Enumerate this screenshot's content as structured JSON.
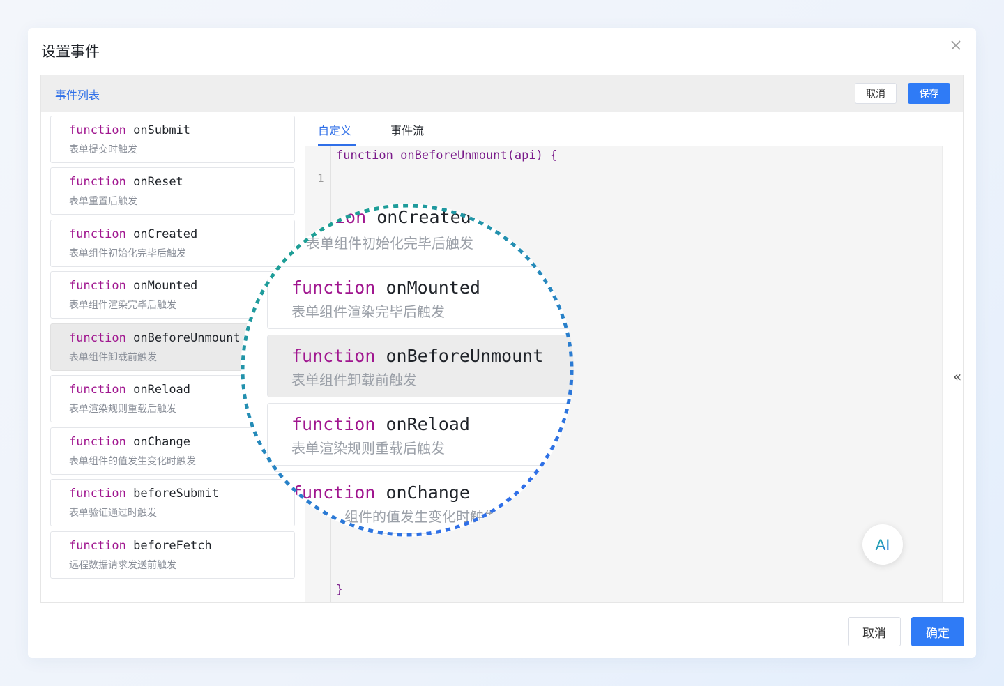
{
  "dialog": {
    "title": "设置事件"
  },
  "panel": {
    "title": "事件列表",
    "cancel_label": "取消",
    "save_label": "保存"
  },
  "events": [
    {
      "keyword": "function",
      "name": "onSubmit",
      "desc": "表单提交时触发"
    },
    {
      "keyword": "function",
      "name": "onReset",
      "desc": "表单重置后触发"
    },
    {
      "keyword": "function",
      "name": "onCreated",
      "desc": "表单组件初始化完毕后触发"
    },
    {
      "keyword": "function",
      "name": "onMounted",
      "desc": "表单组件渲染完毕后触发"
    },
    {
      "keyword": "function",
      "name": "onBeforeUnmount",
      "desc": "表单组件卸载前触发"
    },
    {
      "keyword": "function",
      "name": "onReload",
      "desc": "表单渲染规则重载后触发"
    },
    {
      "keyword": "function",
      "name": "onChange",
      "desc": "表单组件的值发生变化时触发"
    },
    {
      "keyword": "function",
      "name": "beforeSubmit",
      "desc": "表单验证通过时触发"
    },
    {
      "keyword": "function",
      "name": "beforeFetch",
      "desc": "远程数据请求发送前触发"
    }
  ],
  "tabs": [
    {
      "label": "自定义"
    },
    {
      "label": "事件流"
    }
  ],
  "editor": {
    "line1": "function onBeforeUnmount(api) {",
    "line_number": "1",
    "closing": "}"
  },
  "ai_label": "AI",
  "footer": {
    "cancel_label": "取消",
    "confirm_label": "确定"
  },
  "magnifier": {
    "partial_top_keyword": "ion",
    "partial_bottom_desc": "组件的值发生变化时触发"
  },
  "colors": {
    "primary": "#2f7bf6",
    "keyword": "#a0168f",
    "ring_green": "#1aa885",
    "ring_blue": "#2f6fe8"
  }
}
